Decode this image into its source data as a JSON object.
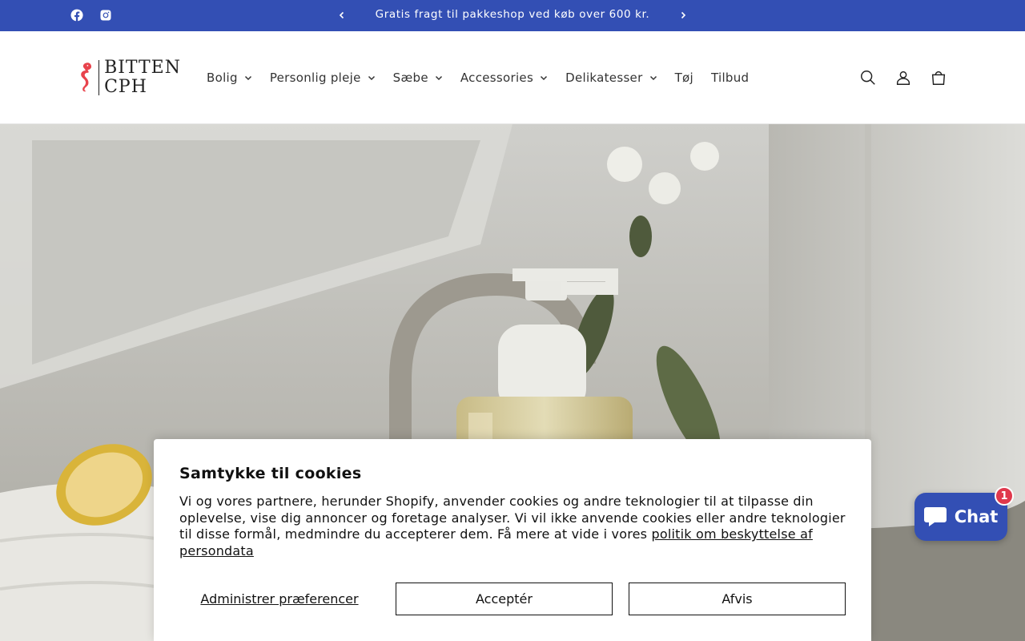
{
  "announcement": {
    "text": "Gratis fragt til pakkeshop ved køb over 600 kr.",
    "social": [
      "facebook-icon",
      "instagram-icon"
    ]
  },
  "brand": {
    "line1": "BITTEN",
    "line2": "CPH",
    "accent_color": "#e8434c"
  },
  "nav": [
    {
      "label": "Bolig",
      "dropdown": true
    },
    {
      "label": "Personlig pleje",
      "dropdown": true
    },
    {
      "label": "Sæbe",
      "dropdown": true
    },
    {
      "label": "Accessories",
      "dropdown": true
    },
    {
      "label": "Delikatesser",
      "dropdown": true
    },
    {
      "label": "Tøj",
      "dropdown": false
    },
    {
      "label": "Tilbud",
      "dropdown": false
    }
  ],
  "header_icons": [
    "search-icon",
    "account-icon",
    "cart-icon"
  ],
  "cookie": {
    "title": "Samtykke til cookies",
    "body": "Vi og vores partnere, herunder Shopify, anvender cookies og andre teknologier til at tilpasse din oplevelse, vise dig annoncer og foretage analyser. Vi vil ikke anvende cookies eller andre teknologier til disse formål, medmindre du accepterer dem. Få mere at vide i vores ",
    "link": "politik om beskyttelse af persondata",
    "manage_label": "Administrer præferencer",
    "accept_label": "Acceptér",
    "decline_label": "Afvis"
  },
  "chat": {
    "label": "Chat",
    "badge": "1"
  },
  "colors": {
    "primary": "#334fb4",
    "badge": "#e0384c"
  }
}
